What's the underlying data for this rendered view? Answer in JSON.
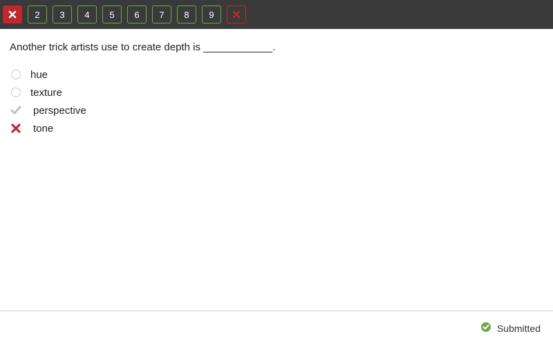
{
  "nav": {
    "items": [
      {
        "type": "icon",
        "icon": "x",
        "style": "filled"
      },
      {
        "type": "num",
        "label": "2",
        "style": "outlined-green"
      },
      {
        "type": "num",
        "label": "3",
        "style": "outlined-green"
      },
      {
        "type": "num",
        "label": "4",
        "style": "outlined-green"
      },
      {
        "type": "num",
        "label": "5",
        "style": "outlined-green"
      },
      {
        "type": "num",
        "label": "6",
        "style": "outlined-green"
      },
      {
        "type": "num",
        "label": "7",
        "style": "outlined-green"
      },
      {
        "type": "num",
        "label": "8",
        "style": "outlined-green"
      },
      {
        "type": "num",
        "label": "9",
        "style": "outlined-green"
      },
      {
        "type": "icon",
        "icon": "x",
        "style": "outlined-red"
      }
    ]
  },
  "question": {
    "text": "Another trick artists use to create depth is ____________.",
    "options": [
      {
        "label": "hue",
        "state": "empty"
      },
      {
        "label": "texture",
        "state": "empty"
      },
      {
        "label": "perspective",
        "state": "correct"
      },
      {
        "label": "tone",
        "state": "wrong"
      }
    ]
  },
  "footer": {
    "status": "Submitted"
  },
  "colors": {
    "red": "#c1272d",
    "green": "#6fa84f",
    "grey": "#bfbfbf"
  }
}
